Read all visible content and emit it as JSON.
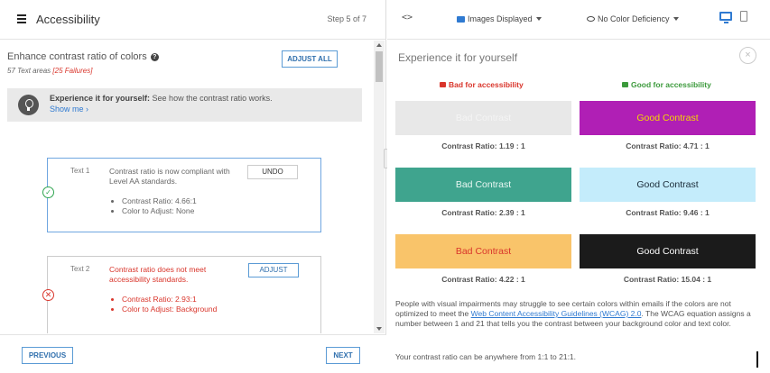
{
  "left": {
    "header": {
      "title": "Accessibility",
      "step": "Step 5 of 7"
    },
    "section": {
      "title": "Enhance contrast ratio of colors",
      "help_glyph": "?",
      "areas_text": "57 Text areas",
      "failures_text": "[25 Failures]",
      "adjust_all_label": "ADJUST ALL"
    },
    "experience": {
      "bold": "Experience it for yourself:",
      "text": " See how the contrast ratio works.",
      "link": "Show me ›"
    },
    "cards": [
      {
        "name": "Text 1",
        "message": "Contrast ratio is now compliant with Level AA standards.",
        "details": [
          "Contrast Ratio: 4.66:1",
          "Color to Adjust: None"
        ],
        "button": "UNDO",
        "status_glyph": "✓"
      },
      {
        "name": "Text 2",
        "message": "Contrast ratio does not meet accessibility standards.",
        "details": [
          "Contrast Ratio: 2.93:1",
          "Color to Adjust: Background"
        ],
        "button": "ADJUST",
        "status_glyph": "✕"
      }
    ],
    "footer": {
      "prev_label": "PREVIOUS",
      "next_label": "NEXT"
    }
  },
  "right": {
    "header": {
      "code_glyph": "<>",
      "images_dropdown": "Images Displayed",
      "color_dropdown": "No Color Deficiency",
      "icons": [
        "code-icon",
        "image-icon",
        "eye-icon",
        "desktop-icon",
        "mobile-icon"
      ]
    },
    "preview": {
      "title": "Experience it for yourself",
      "close_glyph": "×",
      "bad_label": "Bad for accessibility",
      "good_label": "Good for accessibility",
      "swatches": [
        {
          "label": "Bad Contrast",
          "bg": "#e8e8e8",
          "fg": "#f4f4f4",
          "ratio": "Contrast Ratio: 1.19 : 1"
        },
        {
          "label": "Good Contrast",
          "bg": "#b01fb5",
          "fg": "#f5d800",
          "ratio": "Contrast Ratio: 4.71 : 1"
        },
        {
          "label": "Bad Contrast",
          "bg": "#3fa48e",
          "fg": "#eaf7f3",
          "ratio": "Contrast Ratio: 2.39 : 1"
        },
        {
          "label": "Good Contrast",
          "bg": "#c4ecfb",
          "fg": "#1a2b38",
          "ratio": "Contrast Ratio: 9.46 : 1"
        },
        {
          "label": "Bad Contrast",
          "bg": "#f9c46a",
          "fg": "#d9352b",
          "ratio": "Contrast Ratio: 4.22 : 1"
        },
        {
          "label": "Good Contrast",
          "bg": "#1b1b1b",
          "fg": "#ffffff",
          "ratio": "Contrast Ratio: 15.04 : 1"
        }
      ],
      "paragraph_before": "People with visual impairments may struggle to see certain colors within emails if the colors are not optimized to meet the ",
      "paragraph_link": "Web Content Accessibility Guidelines (WCAG) 2.0",
      "paragraph_after": ". The WCAG equation assigns a number between 1 and 21 that tells you the contrast between your background color and text color.",
      "paragraph2": "Your contrast ratio can be anywhere from 1:1 to 21:1."
    }
  },
  "colors": {
    "accent_blue": "#2f7ad1",
    "fail_red": "#d9352b",
    "pass_green": "#2ea44f"
  }
}
